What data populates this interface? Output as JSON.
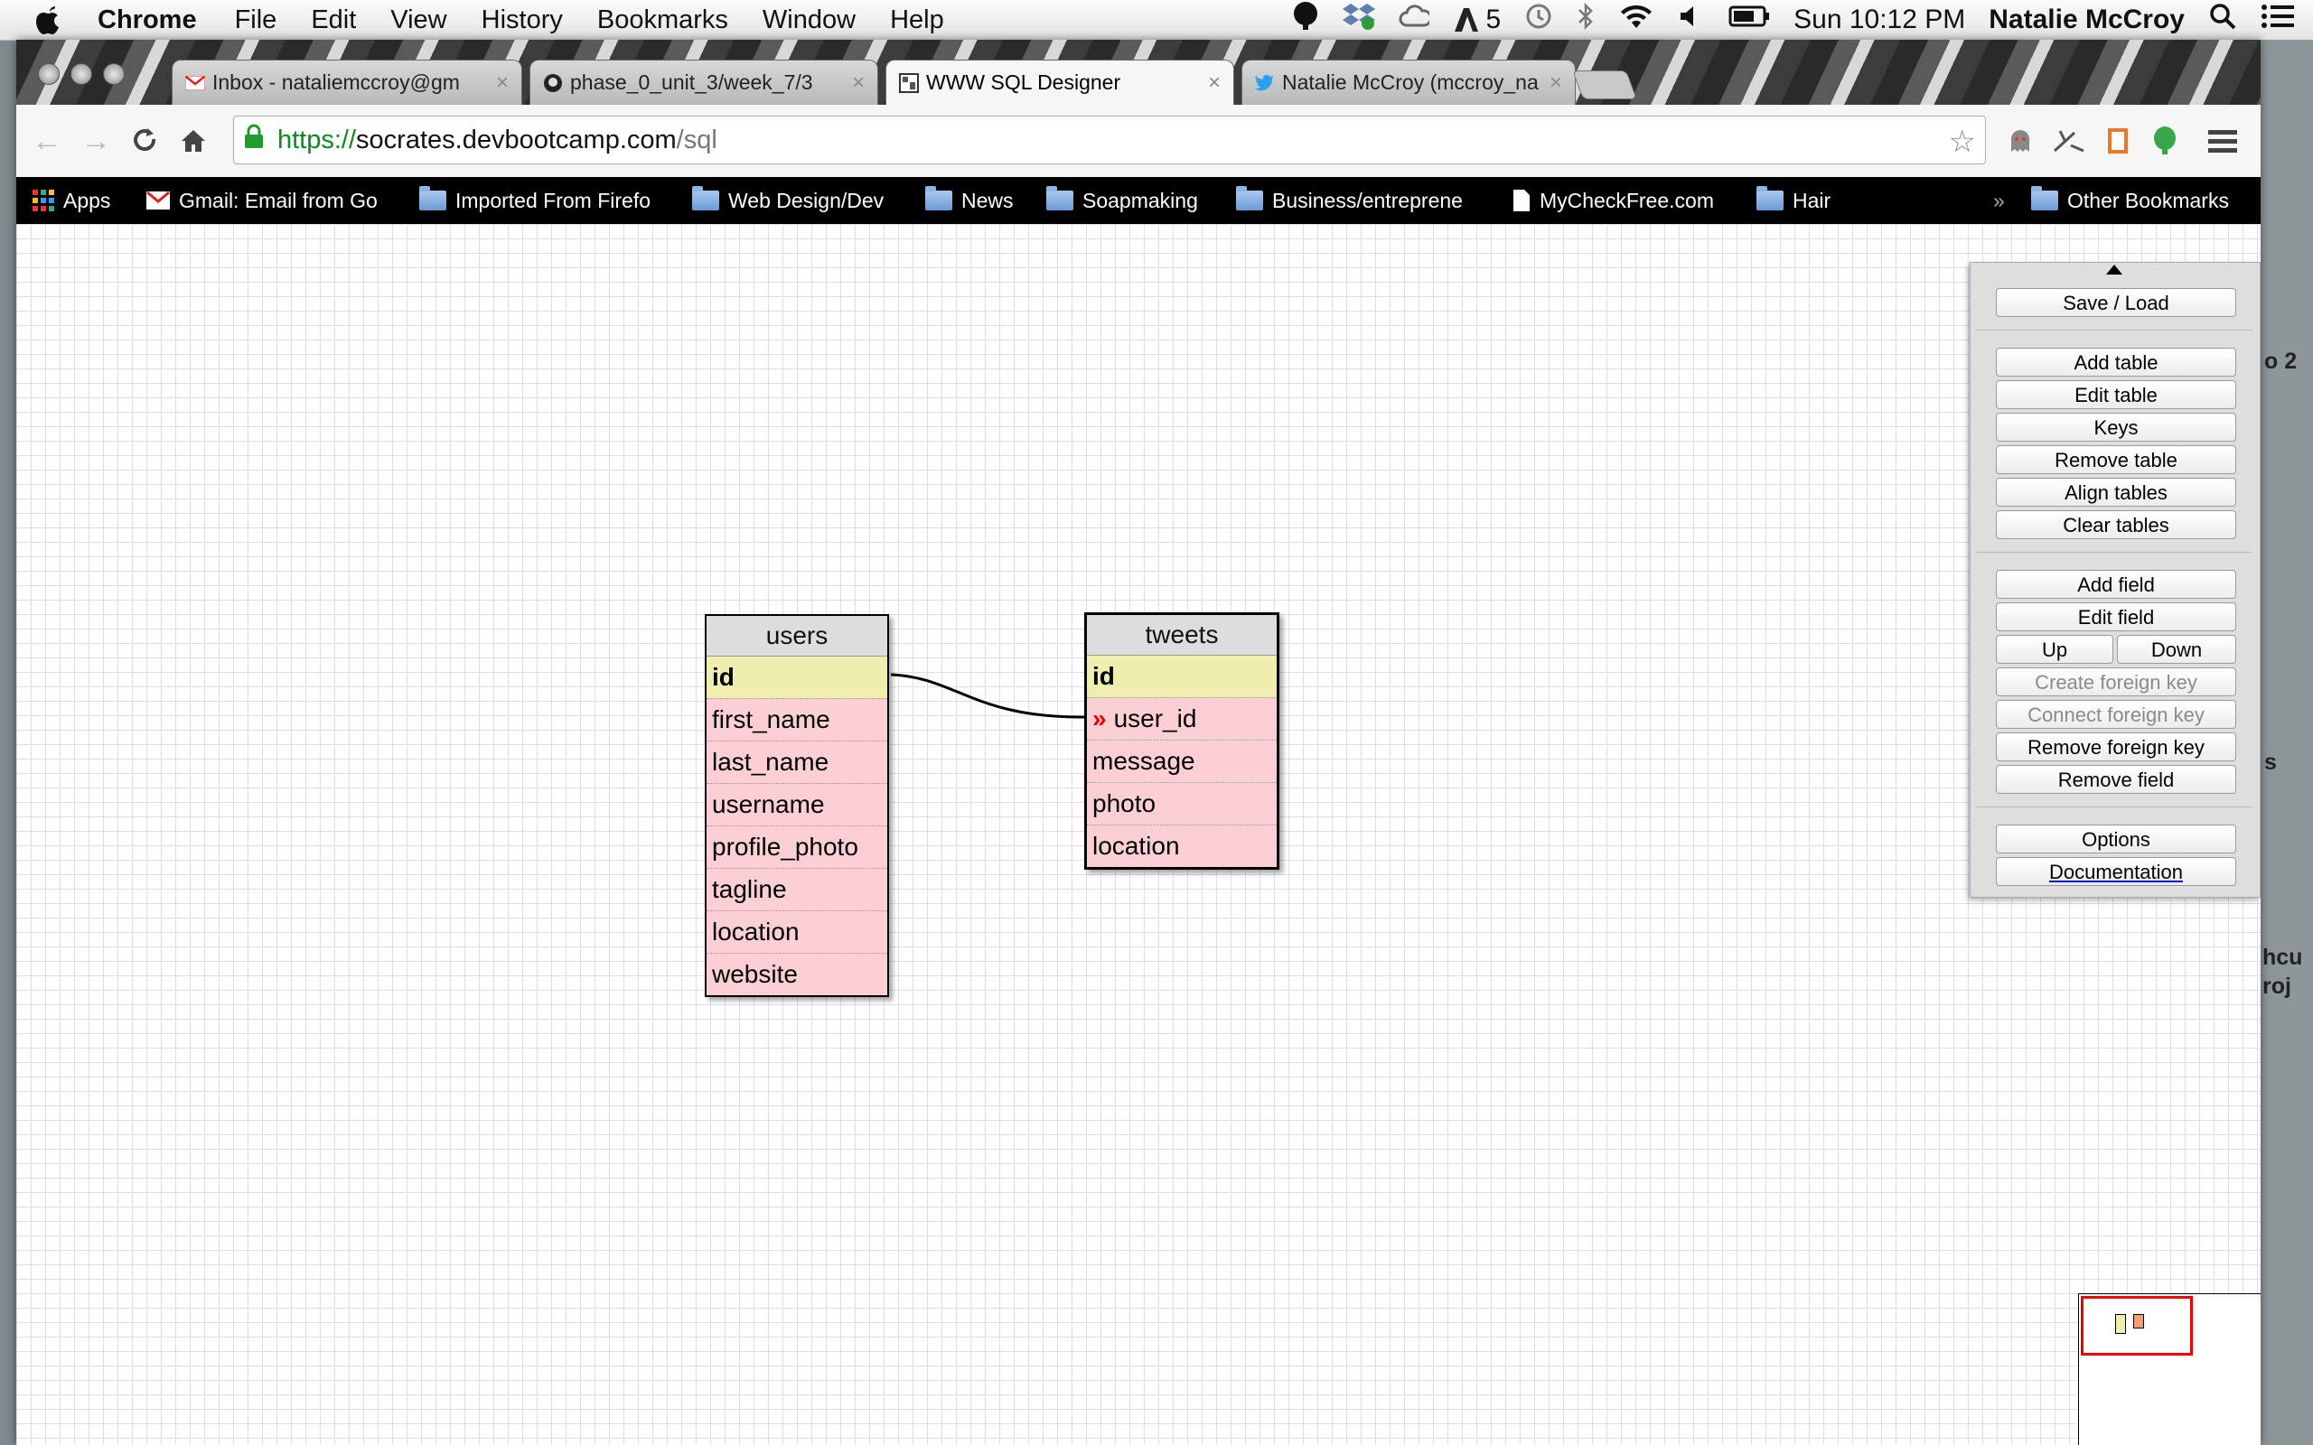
{
  "menubar": {
    "app": "Chrome",
    "items": [
      "File",
      "Edit",
      "View",
      "History",
      "Bookmarks",
      "Window",
      "Help"
    ],
    "adobe_count": "5",
    "clock": "Sun 10:12 PM",
    "user": "Natalie McCroy"
  },
  "desktop": {
    "text1": "o 2",
    "text2": "s",
    "text3": "hcu",
    "text4": "roj"
  },
  "tabs": [
    {
      "title": "Inbox - nataliemccroy@gm",
      "icon": "gmail-icon"
    },
    {
      "title": "phase_0_unit_3/week_7/3",
      "icon": "github-icon"
    },
    {
      "title": "WWW SQL Designer",
      "icon": "page-icon"
    },
    {
      "title": "Natalie McCroy (mccroy_na",
      "icon": "twitter-icon"
    }
  ],
  "omnibox": {
    "scheme": "https://",
    "host": "socrates.devbootcamp.com",
    "path": "/sql"
  },
  "bookmarks": {
    "apps": "Apps",
    "gmail": "Gmail: Email from Go",
    "imported": "Imported From Firefo",
    "webdesign": "Web Design/Dev",
    "news": "News",
    "soap": "Soapmaking",
    "business": "Business/entreprene",
    "checkfree": "MyCheckFree.com",
    "hair": "Hair",
    "overflow": "»",
    "other": "Other Bookmarks"
  },
  "tables": {
    "users": {
      "name": "users",
      "fields": [
        "id",
        "first_name",
        "last_name",
        "username",
        "profile_photo",
        "tagline",
        "location",
        "website"
      ]
    },
    "tweets": {
      "name": "tweets",
      "fields": [
        "id",
        "user_id",
        "message",
        "photo",
        "location"
      ],
      "fk_marker": "»"
    }
  },
  "panel": {
    "save_load": "Save / Load",
    "add_table": "Add table",
    "edit_table": "Edit table",
    "keys": "Keys",
    "remove_table": "Remove table",
    "align_tables": "Align tables",
    "clear_tables": "Clear tables",
    "add_field": "Add field",
    "edit_field": "Edit field",
    "up": "Up",
    "down": "Down",
    "create_fk": "Create foreign key",
    "connect_fk": "Connect foreign key",
    "remove_fk": "Remove foreign key",
    "remove_field": "Remove field",
    "options": "Options",
    "documentation": "Documentation"
  },
  "colors": {
    "pk_row": "#f0eeaf",
    "field_row": "#fccfd5",
    "fk_marker": "#ee0000",
    "url_scheme": "#0a8a23",
    "minimap_view": "#ee0000"
  }
}
